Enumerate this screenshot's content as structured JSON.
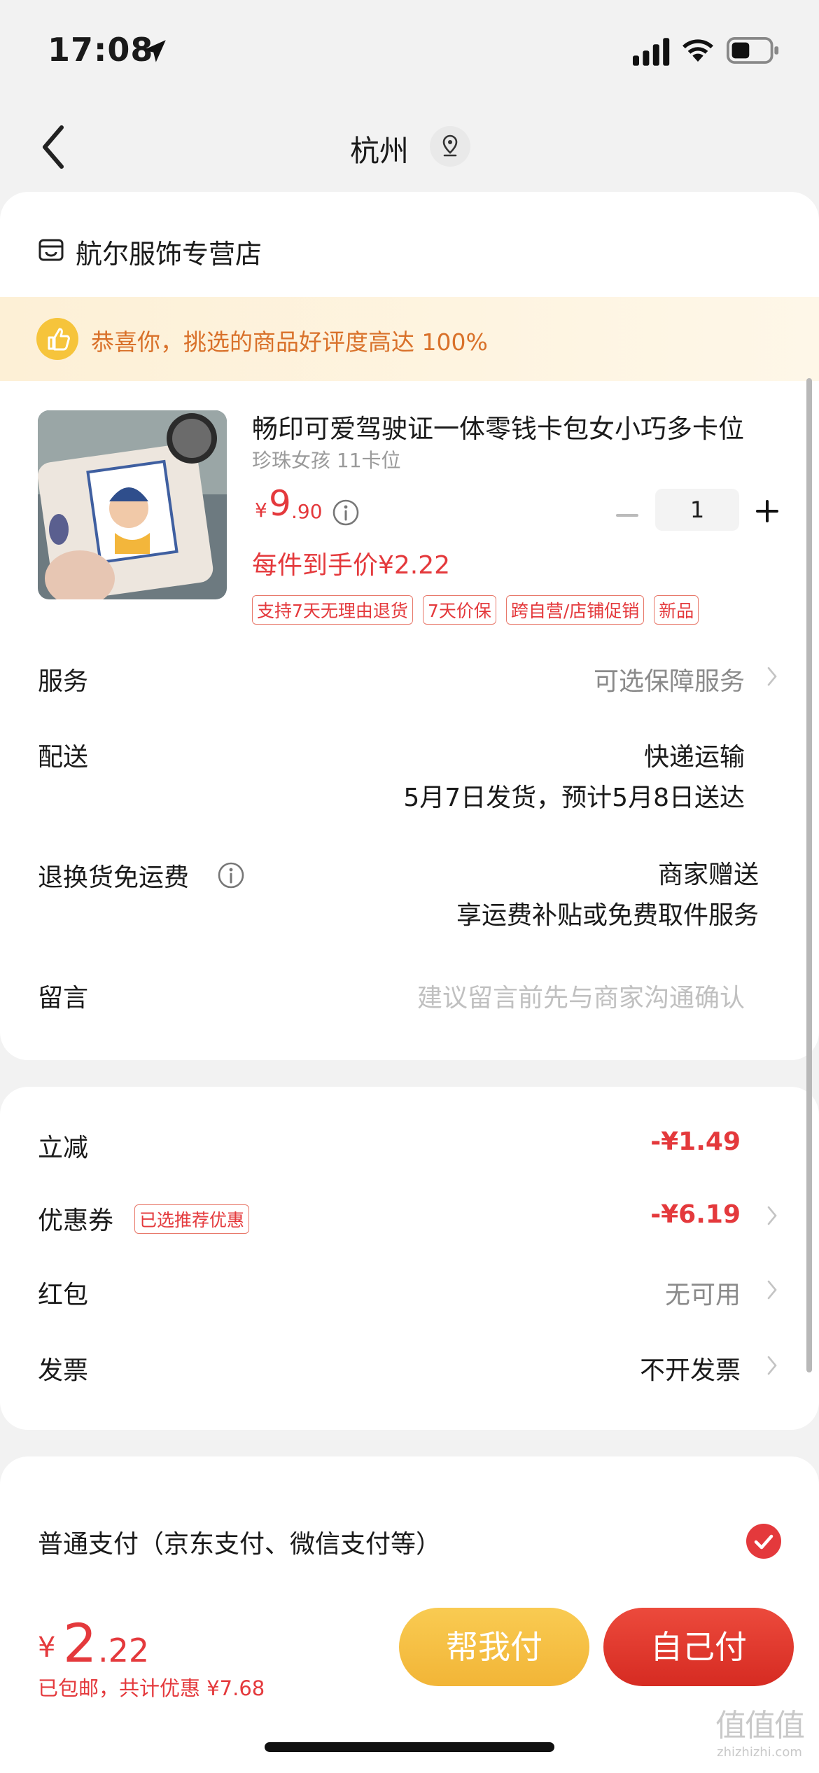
{
  "status_bar": {
    "time": "17:08"
  },
  "nav": {
    "title": "杭州"
  },
  "shop": {
    "name": "航尔服饰专营店",
    "banner": "恭喜你，挑选的商品好评度高达 100%"
  },
  "product": {
    "title": "畅印可爱驾驶证一体零钱卡包女小巧多卡位",
    "spec": "珍珠女孩 11卡位",
    "price_symbol": "¥",
    "price_int": "9",
    "price_dec": ".90",
    "quantity": "1",
    "unit_price": "每件到手价¥2.22",
    "tags": [
      "支持7天无理由退货",
      "7天价保",
      "跨自营/店铺促销",
      "新品"
    ]
  },
  "rows": {
    "service_label": "服务",
    "service_value": "可选保障服务",
    "delivery_label": "配送",
    "delivery_method": "快递运输",
    "delivery_time": "5月7日发货，预计5月8日送达",
    "return_label": "退换货免运费",
    "return_value1": "商家赠送",
    "return_value2": "享运费补贴或免费取件服务",
    "message_label": "留言",
    "message_placeholder": "建议留言前先与商家沟通确认"
  },
  "discounts": {
    "instant_label": "立减",
    "instant_value": "-¥1.49",
    "coupon_label": "优惠券",
    "coupon_badge": "已选推荐优惠",
    "coupon_value": "-¥6.19",
    "redpacket_label": "红包",
    "redpacket_value": "无可用",
    "invoice_label": "发票",
    "invoice_value": "不开发票"
  },
  "payment": {
    "normal_label": "普通支付（京东支付、微信支付等）"
  },
  "bottom": {
    "total_symbol": "¥",
    "total_int": "2",
    "total_dec": ".22",
    "total_sub": "已包邮，共计优惠 ¥7.68",
    "help_pay": "帮我付",
    "self_pay": "自己付"
  },
  "watermark": {
    "logo": "值值值",
    "url": "zhizhizhi.com"
  },
  "colors": {
    "accent": "#e4393c",
    "gold": "#f2b537",
    "banner_text": "#d9712a"
  }
}
